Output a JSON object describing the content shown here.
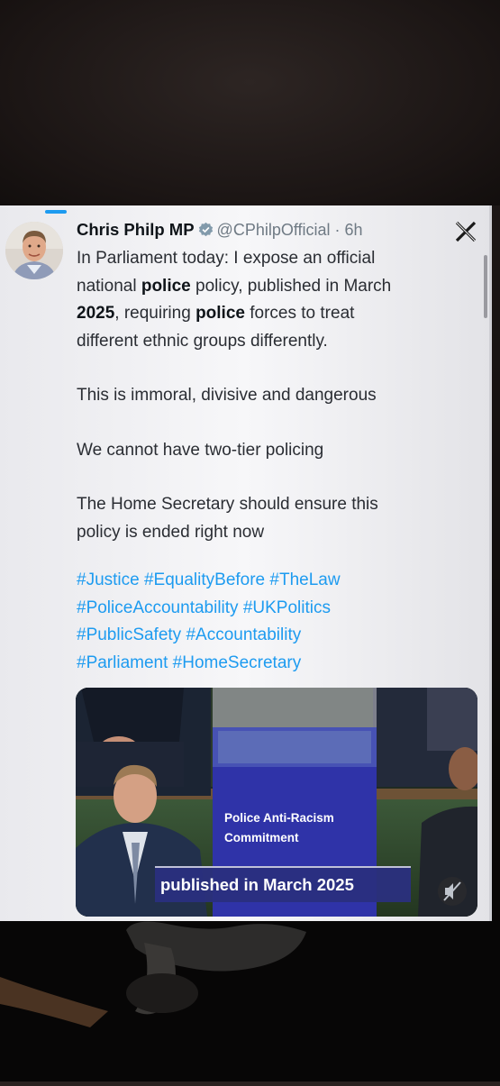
{
  "tweet": {
    "author_name": "Chris Philp MP",
    "handle_time": "@CPhilpOfficial · 6h",
    "lines": [
      [
        {
          "t": "In Parliament today: I expose an official"
        }
      ],
      [
        {
          "t": "national "
        },
        {
          "t": "police",
          "b": true
        },
        {
          "t": " policy, published in March"
        }
      ],
      [
        {
          "t": "2025",
          "b": true
        },
        {
          "t": ", requiring "
        },
        {
          "t": "police",
          "b": true
        },
        {
          "t": " forces to treat"
        }
      ],
      [
        {
          "t": "different ethnic groups differently."
        }
      ],
      [],
      [
        {
          "t": "This is immoral, divisive and dangerous"
        }
      ],
      [],
      [
        {
          "t": "We cannot have two-tier policing"
        }
      ],
      [],
      [
        {
          "t": "The Home Secretary should ensure this"
        }
      ],
      [
        {
          "t": "policy is ended right now"
        }
      ]
    ],
    "hashtag_lines": [
      "#Justice #EqualityBefore #TheLaw",
      "#PoliceAccountability #UKPolitics",
      "#PublicSafety #Accountability",
      "#Parliament #HomeSecretary"
    ]
  },
  "media": {
    "doc_title_line1": "Police Anti-Racism",
    "doc_title_line2": "Commitment",
    "caption": "published in March 2025"
  },
  "colors": {
    "link": "#1d9bf0",
    "verified": "#829aab",
    "doc_blue": "#2f33a8"
  },
  "icons": [
    "verified-badge-icon",
    "close-icon",
    "mute-icon"
  ]
}
